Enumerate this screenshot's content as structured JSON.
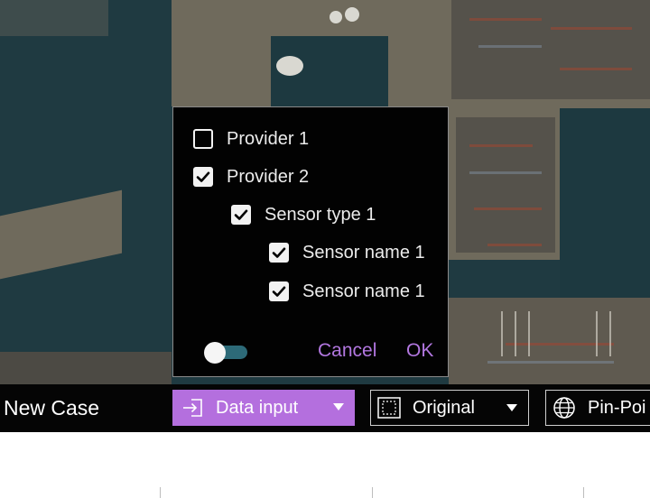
{
  "colors": {
    "accent": "#b46fde",
    "dialog_action_text": "#b277e0",
    "toggle_track": "#2d6a78",
    "toolbar_bg": "#050505",
    "dialog_bg": "#020202"
  },
  "map": {
    "icon": "satellite-map-background"
  },
  "dialog": {
    "options": [
      {
        "label": "Provider 1",
        "checked": false,
        "level": 0
      },
      {
        "label": "Provider 2",
        "checked": true,
        "level": 0
      },
      {
        "label": "Sensor type 1",
        "checked": true,
        "level": 1
      },
      {
        "label": "Sensor name 1",
        "checked": true,
        "level": 2
      },
      {
        "label": "Sensor name 1",
        "checked": true,
        "level": 2
      }
    ],
    "toggle": {
      "on": false
    },
    "cancel_label": "Cancel",
    "ok_label": "OK"
  },
  "toolbar": {
    "case_label": "New Case",
    "data_input": {
      "label": "Data input",
      "icon": "import-icon"
    },
    "original": {
      "label": "Original",
      "icon": "frame-icon"
    },
    "pin_point": {
      "label": "Pin-Poi",
      "icon": "globe-icon"
    }
  }
}
